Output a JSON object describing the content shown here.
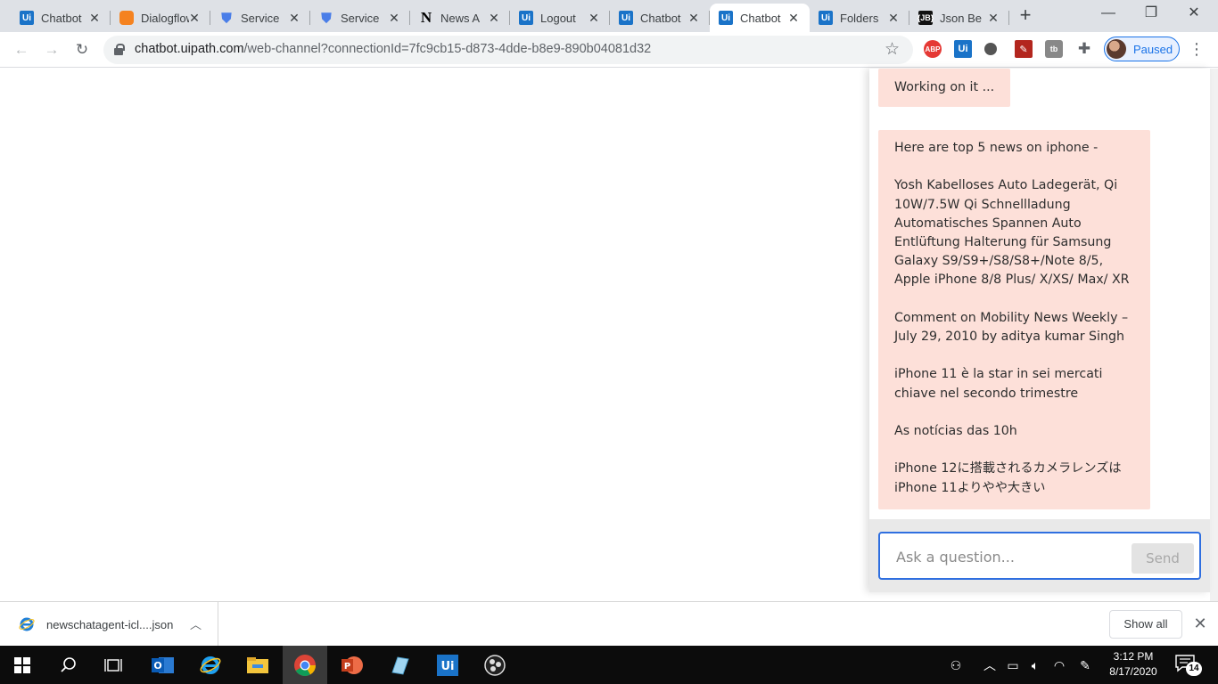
{
  "browser": {
    "tabs": [
      {
        "title": "Chatbot",
        "favicon": "uipath-icon"
      },
      {
        "title": "Dialogflow",
        "favicon": "dialogflow-icon"
      },
      {
        "title": "Service",
        "favicon": "shield-icon"
      },
      {
        "title": "Service",
        "favicon": "shield-icon"
      },
      {
        "title": "News A",
        "favicon": "notion-icon"
      },
      {
        "title": "Logout",
        "favicon": "uipath-icon"
      },
      {
        "title": "Chatbot",
        "favicon": "uipath-icon"
      },
      {
        "title": "Chatbot",
        "favicon": "uipath-icon",
        "active": true
      },
      {
        "title": "Folders",
        "favicon": "uipath-icon"
      },
      {
        "title": "Json Be",
        "favicon": "json-icon"
      }
    ],
    "url_host": "chatbot.uipath.com",
    "url_path": "/web-channel?connectionId=7fc9cb15-d873-4dde-b8e9-890b04081d32",
    "profile_label": "Paused"
  },
  "chat": {
    "status_message": "Working on it ...",
    "news_intro": "Here are top 5 news on iphone -",
    "news_items": [
      "Yosh Kabelloses Auto Ladegerät, Qi 10W/7.5W Qi Schnellladung Automatisches Spannen Auto Entlüftung Halterung für Samsung Galaxy S9/S9+/S8/S8+/Note 8/5, Apple iPhone 8/8 Plus/ X/XS/ Max/ XR",
      "Comment on Mobility News Weekly – July 29, 2010 by aditya kumar Singh",
      "iPhone 11 è la star in sei mercati chiave nel secondo trimestre",
      "As notícias das 10h",
      "iPhone 12に搭載されるカメラレンズはiPhone 11よりやや大きい"
    ],
    "input_placeholder": "Ask a question...",
    "send_label": "Send"
  },
  "downloads": {
    "file_name": "newschatagent-icl....json",
    "show_all_label": "Show all"
  },
  "taskbar": {
    "time": "3:12 PM",
    "date": "8/17/2020",
    "notification_count": "14"
  },
  "colors": {
    "bubble": "#fde0d9",
    "input_border": "#2f6fe0",
    "uipath_blue": "#1a73c8",
    "taskbar": "#0c0c0c"
  }
}
